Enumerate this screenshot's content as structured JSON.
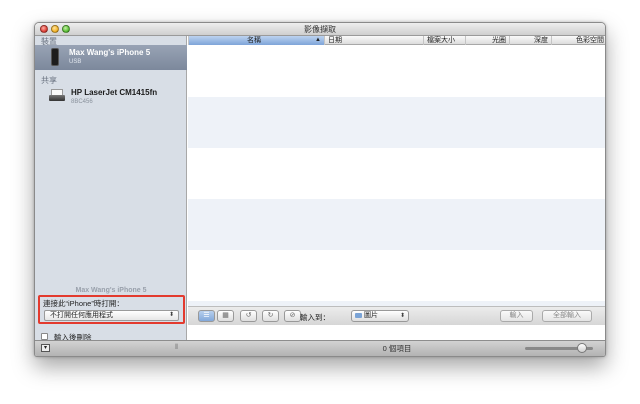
{
  "window": {
    "title": "影像擷取"
  },
  "sidebar": {
    "devices_heading": "裝置",
    "device": {
      "name": "Max Wang's iPhone 5",
      "sub": "USB"
    },
    "shared_heading": "共享",
    "printer": {
      "name": "HP LaserJet CM1415fn",
      "sub": "8BC456"
    },
    "selected_device_label": "Max Wang's iPhone 5",
    "connect_label": "連接此“iPhone”時打開：",
    "connect_value": "不打開任何應用程式",
    "delete_after_import": "輸入後刪除"
  },
  "table": {
    "columns": [
      {
        "label": "名稱",
        "sorted": true
      },
      {
        "label": "日期"
      },
      {
        "label": "檔案大小"
      },
      {
        "label": "光圈"
      },
      {
        "label": "深度"
      },
      {
        "label": "色彩空間"
      }
    ]
  },
  "toolbar": {
    "import_to_label": "輸入到：",
    "destination": "圖片",
    "import_button": "輸入",
    "import_all_button": "全部輸入"
  },
  "status": {
    "count": "0 個項目"
  },
  "colors": {
    "accent": "#7ea4d8",
    "highlight": "#e33a2e",
    "sidebar": "#d8dee6",
    "selection": "#8894a8"
  }
}
